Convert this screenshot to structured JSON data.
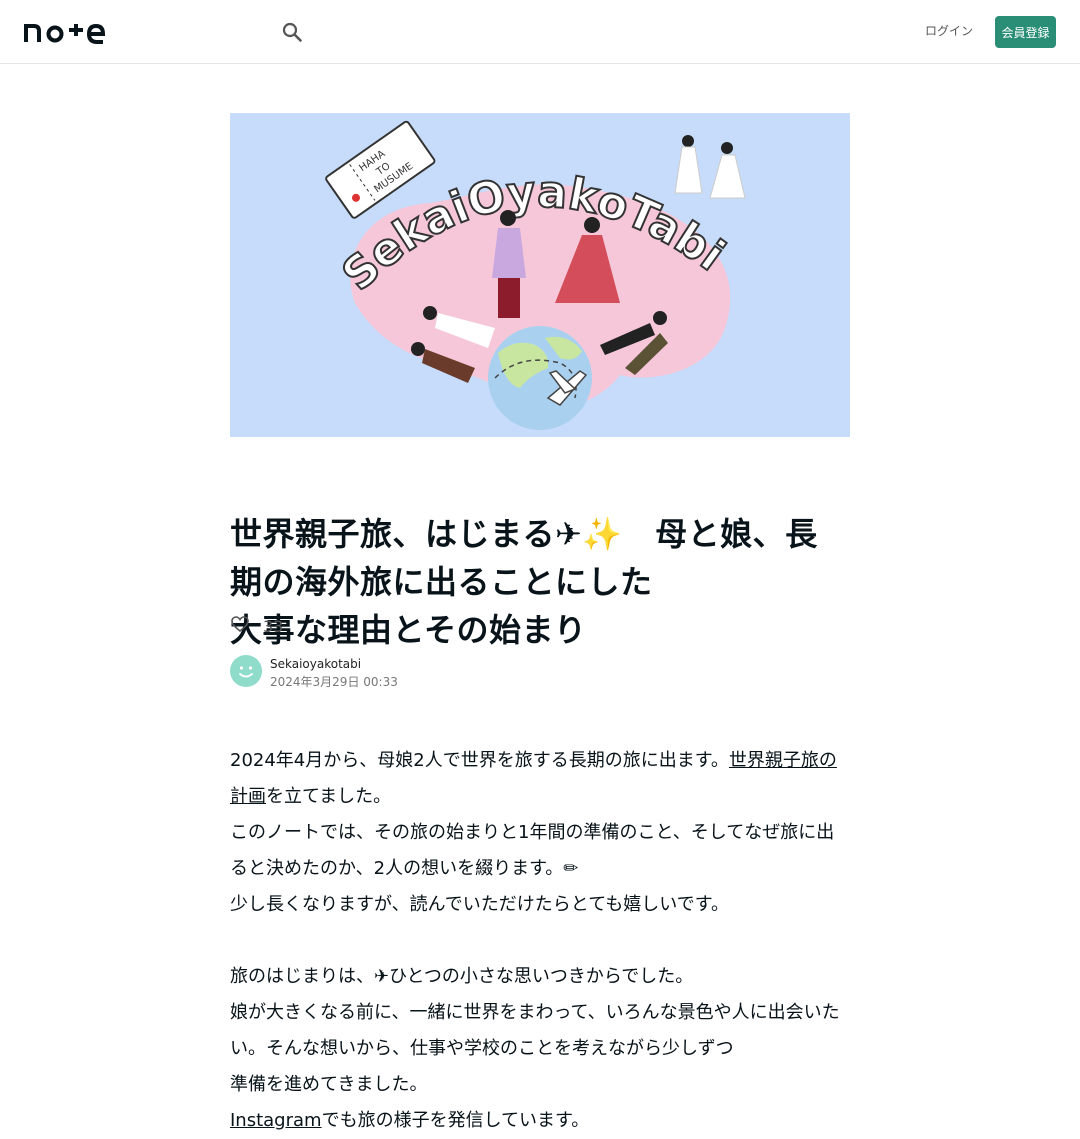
{
  "header": {
    "logo_text": "note",
    "search_icon": "search-icon",
    "login_label": "ログイン",
    "signup_label": "会員登録",
    "accent_color": "#2a8e76"
  },
  "hero": {
    "logo_title": "SekaiOyakoTabi",
    "ticket_text_1": "HAHA",
    "ticket_text_2": "TO",
    "ticket_text_3": "MUSUME",
    "bg_color": "#c6dcfa",
    "blob_color": "#f6c7d8"
  },
  "article": {
    "title_line1": "世界親子旅、はじまる✈︎✨　母と娘、長期の海外旅に出ることにした",
    "title_line2": "大事な理由とその始まり",
    "like_count": "33",
    "author_name": "Sekaioyakotabi",
    "date": "2024年3月29日 00:33",
    "paragraphs": [
      {
        "before": "2024年4月から、母娘2人で世界を旅する長期の旅に出ます。",
        "link": "世界親子旅の計画",
        "after": "を立てました。"
      },
      {
        "text": "このノートでは、その旅の始まりと1年間の準備のこと、そしてなぜ旅に出ると決めたのか、2人の想いを綴ります。✏︎"
      },
      {
        "text": "少し長くなりますが、読んでいただけたらとても嬉しいです。"
      },
      {
        "text": "旅のはじまりは、✈︎ひとつの小さな思いつきからでした。"
      },
      {
        "text": "娘が大きくなる前に、一緒に世界をまわって、いろんな景色や人に出会いたい。そんな想いから、仕事や学校のことを考えながら少しずつ"
      },
      {
        "text": "準備を進めてきました。"
      },
      {
        "link": "Instagram",
        "after": "でも旅の様子を発信しています。"
      }
    ]
  }
}
